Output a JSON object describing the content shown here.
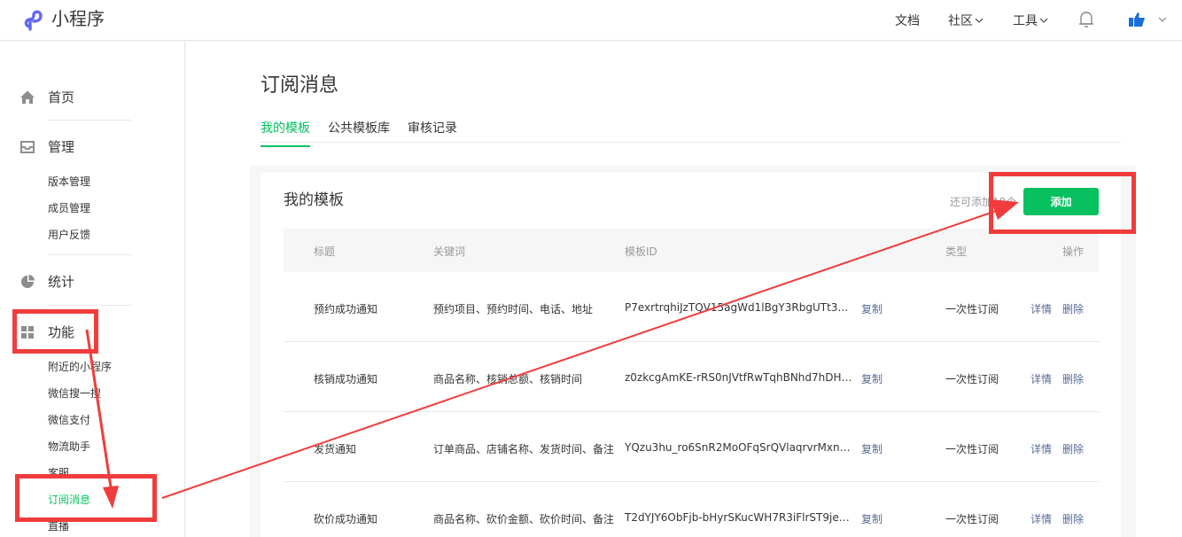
{
  "header": {
    "app_title": "小程序",
    "nav": [
      {
        "label": "文档",
        "has_dropdown": false
      },
      {
        "label": "社区",
        "has_dropdown": true
      },
      {
        "label": "工具",
        "has_dropdown": true
      }
    ],
    "icons": [
      "logo-icon",
      "bell-icon",
      "avatar-icon",
      "chevron-down-icon"
    ]
  },
  "sidebar": {
    "sections": [
      {
        "label": "首页",
        "icon": "home-icon"
      },
      {
        "label": "管理",
        "icon": "inbox-icon"
      },
      {
        "label": "统计",
        "icon": "pie-chart-icon"
      },
      {
        "label": "功能",
        "icon": "grid-icon"
      }
    ],
    "manage_items": [
      "版本管理",
      "成员管理",
      "用户反馈"
    ],
    "feature_items": [
      "附近的小程序",
      "微信搜一搜",
      "微信支付",
      "物流助手",
      "客服",
      "订阅消息",
      "直播"
    ],
    "active_item": "订阅消息"
  },
  "main": {
    "page_title": "订阅消息",
    "tabs": [
      {
        "label": "我的模板",
        "active": true
      },
      {
        "label": "公共模板库",
        "active": false
      },
      {
        "label": "审核记录",
        "active": false
      }
    ],
    "card": {
      "title": "我的模板",
      "remaining_text": "还可添加18个",
      "add_label": "添加"
    },
    "table": {
      "headers": [
        "标题",
        "关键词",
        "模板ID",
        "类型",
        "操作"
      ],
      "rows": [
        {
          "title": "预约成功通知",
          "keywords": "预约项目、预约时间、电话、地址",
          "template_id": "P7exrtrqhiJzTQV15agWd1lBgY3RbgUTt3FO..",
          "copy": "复制",
          "type": "一次性订阅",
          "detail": "详情",
          "delete": "删除"
        },
        {
          "title": "核销成功通知",
          "keywords": "商品名称、核销总额、核销时间",
          "template_id": "z0zkcgAmKE-rRS0nJVtfRwTqhBNhd7hDH1...",
          "copy": "复制",
          "type": "一次性订阅",
          "detail": "详情",
          "delete": "删除"
        },
        {
          "title": "发货通知",
          "keywords": "订单商品、店铺名称、发货时间、备注",
          "template_id": "YQzu3hu_ro6SnR2MoOFqSrQVlaqrvrMxn5...",
          "copy": "复制",
          "type": "一次性订阅",
          "detail": "详情",
          "delete": "删除"
        },
        {
          "title": "砍价成功通知",
          "keywords": "商品名称、砍价金额、砍价时间、备注",
          "template_id": "T2dYJY6ObFjb-bHyrSKucWH7R3iFlrST9jeLB..",
          "copy": "复制",
          "type": "一次性订阅",
          "detail": "详情",
          "delete": "删除"
        }
      ]
    }
  },
  "colors": {
    "accent": "#07c160",
    "link": "#576b95",
    "annotation": "#f03c3c"
  }
}
